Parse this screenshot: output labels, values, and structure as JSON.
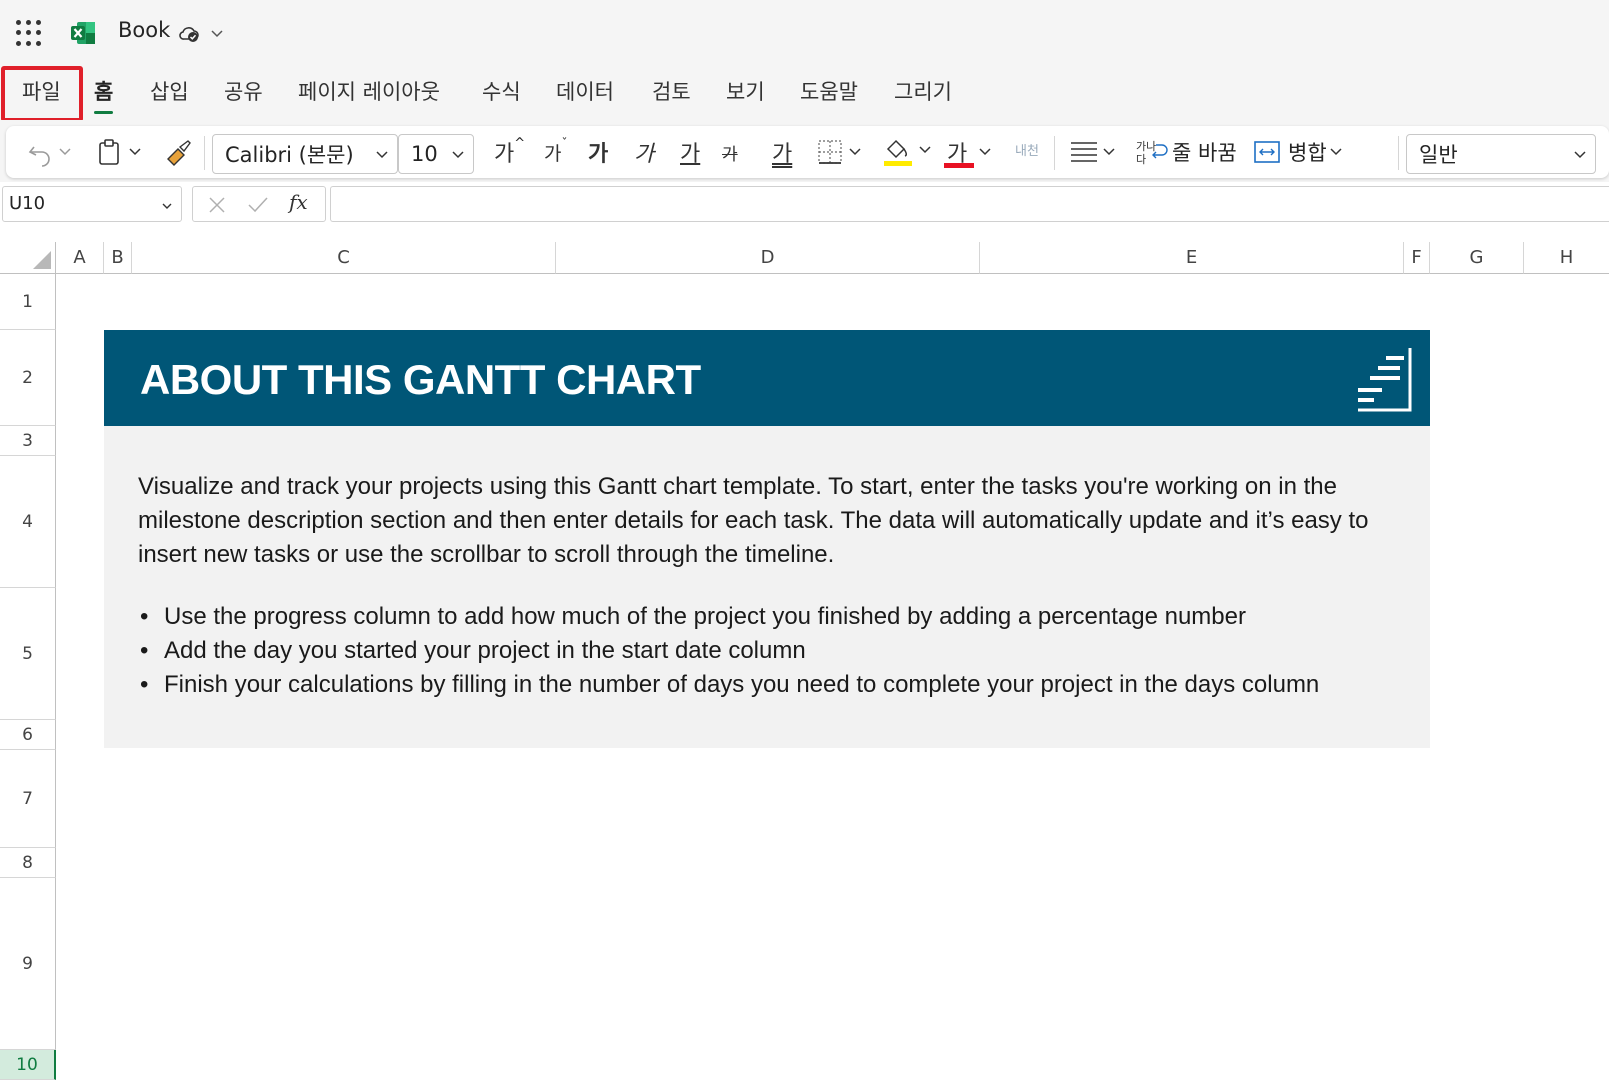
{
  "titlebar": {
    "app_icon": "excel-icon",
    "book_name": "Book"
  },
  "menu": {
    "tabs": [
      {
        "label": "파일"
      },
      {
        "label": "홈"
      },
      {
        "label": "삽입"
      },
      {
        "label": "공유"
      },
      {
        "label": "페이지 레이아웃"
      },
      {
        "label": "수식"
      },
      {
        "label": "데이터"
      },
      {
        "label": "검토"
      },
      {
        "label": "보기"
      },
      {
        "label": "도움말"
      },
      {
        "label": "그리기"
      }
    ],
    "active_tab": "홈",
    "highlighted_tab": "파일"
  },
  "ribbon": {
    "font_name": "Calibri (본문)",
    "font_size": "10",
    "grow_font": "가",
    "shrink_font": "가",
    "bold": "가",
    "italic": "가",
    "underline": "가",
    "strikethrough": "가",
    "double_underline": "가",
    "font_color": "가",
    "indent_glyph": "내천",
    "wrap_text": "줄 바꿈",
    "merge": "병합",
    "number_format": "일반",
    "fill_color": "#ffeb00",
    "font_color_bar": "#e81123"
  },
  "formula_bar": {
    "name_box": "U10",
    "function_label": "fx",
    "formula": ""
  },
  "columns": [
    "A",
    "B",
    "C",
    "D",
    "E",
    "F",
    "G",
    "H"
  ],
  "rows": [
    "1",
    "2",
    "3",
    "4",
    "5",
    "6",
    "7",
    "8",
    "9",
    "10"
  ],
  "selected_row": "10",
  "sheet": {
    "banner_title": "ABOUT THIS GANTT CHART",
    "banner_color": "#005677",
    "paragraph": "Visualize and track your projects using this Gantt chart template. To start, enter the tasks you're working on in the milestone description section and then enter details for each task. The data will automatically update and it’s easy to insert new tasks or use the scrollbar to scroll through the timeline.",
    "bullets": [
      "Use the progress column to add how much of the project you finished by adding a percentage number",
      "Add the day you started your project in the start date column",
      "Finish your calculations by filling in the number of days you need to complete your project in the days column"
    ]
  }
}
